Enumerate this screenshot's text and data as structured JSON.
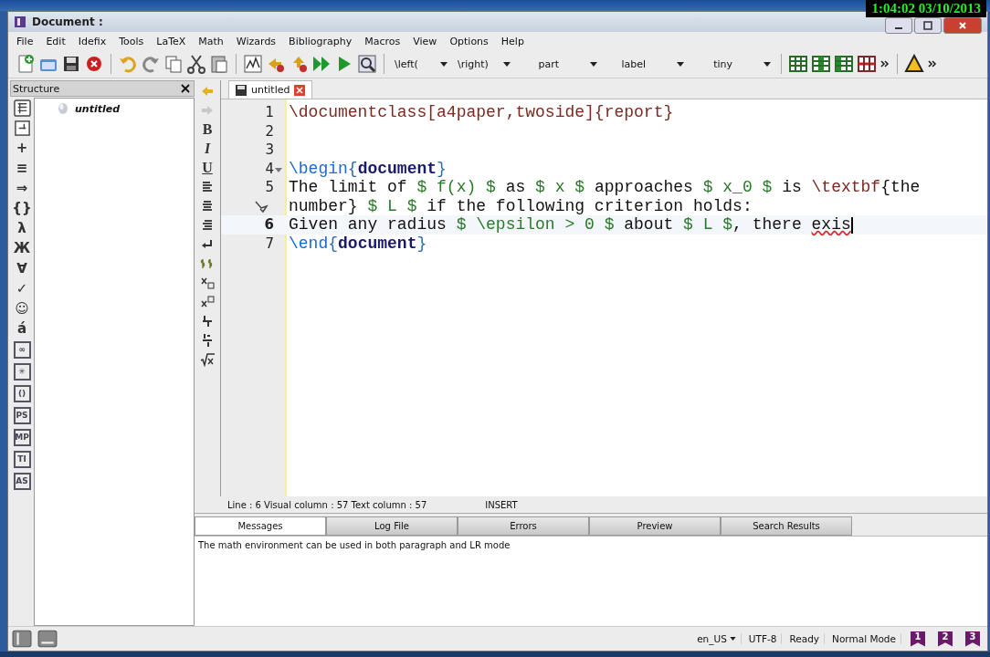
{
  "clock": "1:04:02  03/10/2013",
  "window": {
    "title": "Document :"
  },
  "menu": [
    "File",
    "Edit",
    "Idefix",
    "Tools",
    "LaTeX",
    "Math",
    "Wizards",
    "Bibliography",
    "Macros",
    "View",
    "Options",
    "Help"
  ],
  "toolbar_combos": [
    {
      "value": "\\left("
    },
    {
      "value": "\\right)"
    },
    {
      "value": "part"
    },
    {
      "value": "label"
    },
    {
      "value": "tiny"
    }
  ],
  "structure": {
    "title": "Structure",
    "tree": [
      {
        "label": "untitled"
      }
    ]
  },
  "palette": [
    {
      "kind": "glyph",
      "glyph": "+"
    },
    {
      "kind": "glyph",
      "glyph": "≡"
    },
    {
      "kind": "glyph",
      "glyph": "⇒"
    },
    {
      "kind": "glyph",
      "glyph": "{}"
    },
    {
      "kind": "glyph",
      "glyph": "λ"
    },
    {
      "kind": "glyph",
      "glyph": "Ж"
    },
    {
      "kind": "glyph",
      "glyph": "∀"
    },
    {
      "kind": "glyph",
      "glyph": "✓"
    },
    {
      "kind": "glyph",
      "glyph": "☺"
    },
    {
      "kind": "glyph",
      "glyph": "á"
    },
    {
      "kind": "boxed",
      "glyph": "∞"
    },
    {
      "kind": "boxed",
      "glyph": "✳"
    },
    {
      "kind": "boxed",
      "glyph": "()"
    },
    {
      "kind": "boxed",
      "glyph": "PS"
    },
    {
      "kind": "boxed",
      "glyph": "MP"
    },
    {
      "kind": "boxed",
      "glyph": "TI"
    },
    {
      "kind": "boxed",
      "glyph": "AS"
    }
  ],
  "format_buttons": [
    "B",
    "I",
    "U"
  ],
  "editor": {
    "tab": {
      "label": "untitled",
      "selected": true
    },
    "rows": [
      {
        "number": "1",
        "current": false,
        "foldable": false,
        "tokens": [
          {
            "kind": "cmd",
            "text": "\\documentclass[a4paper,twoside]{report}"
          }
        ]
      },
      {
        "number": "2",
        "current": false,
        "foldable": false,
        "tokens": []
      },
      {
        "number": "3",
        "current": false,
        "foldable": false,
        "tokens": []
      },
      {
        "number": "4",
        "current": false,
        "foldable": true,
        "tokens": [
          {
            "kind": "begin",
            "text": "\\begin"
          },
          {
            "kind": "brace",
            "text": "{"
          },
          {
            "kind": "env",
            "text": "document"
          },
          {
            "kind": "brace",
            "text": "}"
          }
        ]
      },
      {
        "number": "5",
        "current": false,
        "foldable": false,
        "tokens": [
          {
            "kind": "plain",
            "text": "The limit of "
          },
          {
            "kind": "math",
            "text": "$ f(x) $"
          },
          {
            "kind": "plain",
            "text": " as "
          },
          {
            "kind": "math",
            "text": "$ x $"
          },
          {
            "kind": "plain",
            "text": " approaches "
          },
          {
            "kind": "math",
            "text": "$ x_0 $"
          },
          {
            "kind": "plain",
            "text": " is "
          },
          {
            "kind": "cmd",
            "text": "\\textbf"
          },
          {
            "kind": "plain",
            "text": "{the"
          }
        ]
      },
      {
        "wrap": true,
        "current": false,
        "foldable": false,
        "tokens": [
          {
            "kind": "plain",
            "text": "number} "
          },
          {
            "kind": "math",
            "text": "$ L $"
          },
          {
            "kind": "plain",
            "text": " if the following criterion holds:"
          }
        ]
      },
      {
        "number": "6",
        "current": true,
        "foldable": false,
        "tokens": [
          {
            "kind": "plain",
            "text": "Given any radius "
          },
          {
            "kind": "math",
            "text": "$ \\epsilon > 0 $"
          },
          {
            "kind": "plain",
            "text": " about "
          },
          {
            "kind": "math",
            "text": "$ L $"
          },
          {
            "kind": "plain",
            "text": ", there "
          },
          {
            "kind": "misspelled",
            "text": "exis"
          }
        ]
      },
      {
        "number": "7",
        "current": false,
        "foldable": false,
        "tokens": [
          {
            "kind": "begin",
            "text": "\\end"
          },
          {
            "kind": "brace",
            "text": "{"
          },
          {
            "kind": "env",
            "text": "document"
          },
          {
            "kind": "brace",
            "text": "}"
          }
        ]
      }
    ],
    "position": "Line : 6 Visual column : 57 Text column : 57",
    "mode": "INSERT"
  },
  "bottom_tabs": [
    {
      "label": "Messages",
      "selected": true
    },
    {
      "label": "Log File",
      "selected": false
    },
    {
      "label": "Errors",
      "selected": false
    },
    {
      "label": "Preview",
      "selected": false
    },
    {
      "label": "Search Results",
      "selected": false
    }
  ],
  "message": "The math environment can be used in both paragraph and LR mode",
  "status_bar": {
    "language": "en_US",
    "encoding": "UTF-8",
    "state": "Ready",
    "mode": "Normal Mode",
    "bookmarks": [
      "1",
      "2",
      "3"
    ]
  }
}
